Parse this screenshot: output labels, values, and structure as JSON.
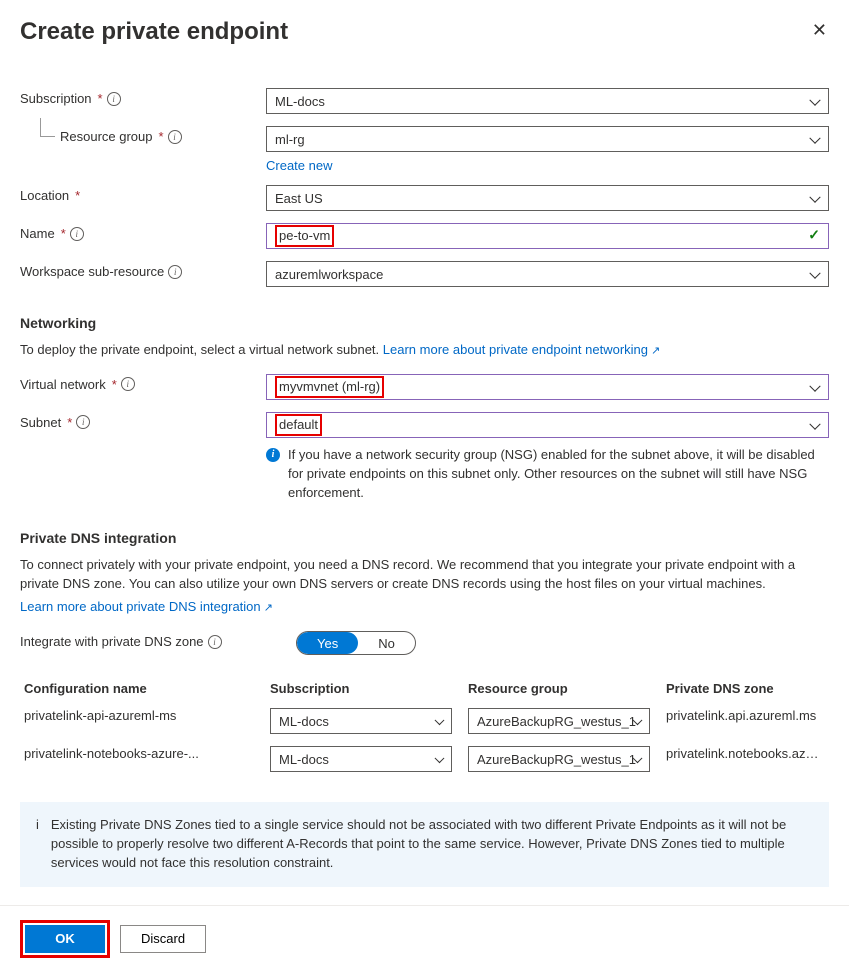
{
  "header": {
    "title": "Create private endpoint"
  },
  "fields": {
    "subscription": {
      "label": "Subscription",
      "value": "ML-docs"
    },
    "resource_group": {
      "label": "Resource group",
      "value": "ml-rg",
      "create_new": "Create new"
    },
    "location": {
      "label": "Location",
      "value": "East US"
    },
    "name": {
      "label": "Name",
      "value": "pe-to-vm"
    },
    "sub_resource": {
      "label": "Workspace sub-resource",
      "value": "azuremlworkspace"
    }
  },
  "networking": {
    "title": "Networking",
    "desc_prefix": "To deploy the private endpoint, select a virtual network subnet. ",
    "learn_more": "Learn more about private endpoint networking",
    "vnet": {
      "label": "Virtual network",
      "value": "myvmvnet (ml-rg)"
    },
    "subnet": {
      "label": "Subnet",
      "value": "default"
    },
    "nsg_note": "If you have a network security group (NSG) enabled for the subnet above, it will be disabled for private endpoints on this subnet only. Other resources on the subnet will still have NSG enforcement."
  },
  "dns": {
    "title": "Private DNS integration",
    "desc": "To connect privately with your private endpoint, you need a DNS record. We recommend that you integrate your private endpoint with a private DNS zone. You can also utilize your own DNS servers or create DNS records using the host files on your virtual machines.",
    "learn_more": "Learn more about private DNS integration",
    "toggle_label": "Integrate with private DNS zone",
    "toggle_yes": "Yes",
    "toggle_no": "No",
    "headers": {
      "c1": "Configuration name",
      "c2": "Subscription",
      "c3": "Resource group",
      "c4": "Private DNS zone"
    },
    "rows": [
      {
        "config": "privatelink-api-azureml-ms",
        "sub": "ML-docs",
        "rg": "AzureBackupRG_westus_1",
        "zone": "privatelink.api.azureml.ms"
      },
      {
        "config": "privatelink-notebooks-azure-...",
        "sub": "ML-docs",
        "rg": "AzureBackupRG_westus_1",
        "zone": "privatelink.notebooks.azure.n..."
      }
    ],
    "callout": "Existing Private DNS Zones tied to a single service should not be associated with two different Private Endpoints as it will not be possible to properly resolve two different A-Records that point to the same service. However, Private DNS Zones tied to multiple services would not face this resolution constraint."
  },
  "footer": {
    "ok": "OK",
    "discard": "Discard"
  }
}
